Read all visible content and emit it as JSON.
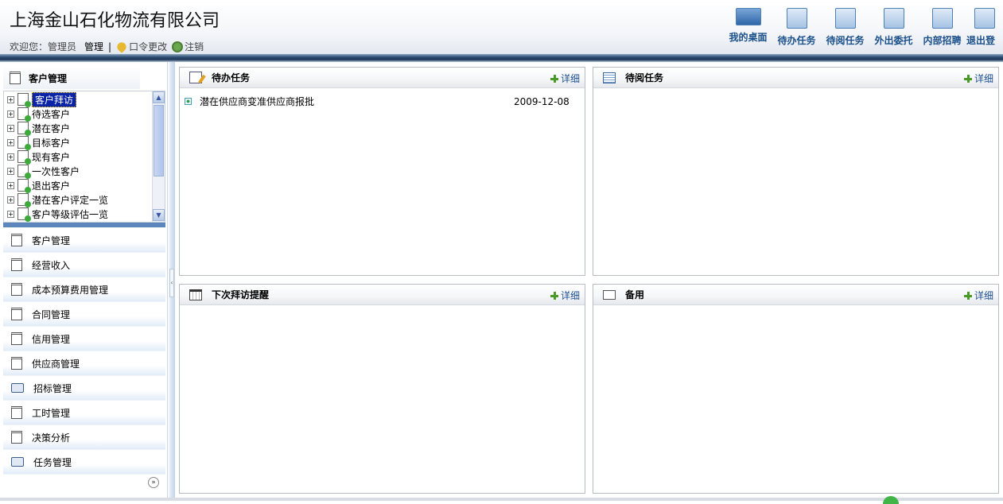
{
  "header": {
    "company": "上海金山石化物流有限公司",
    "welcome": "欢迎您：管理员",
    "manage": "管理",
    "separator": "|",
    "password_change": "口令更改",
    "logout": "注销"
  },
  "topnav": [
    {
      "label": "我的桌面",
      "icon": "desktop-icon"
    },
    {
      "label": "待办任务",
      "icon": "task-list-icon"
    },
    {
      "label": "待阅任务",
      "icon": "table-icon"
    },
    {
      "label": "外出委托",
      "icon": "delegate-icon"
    },
    {
      "label": "内部招聘",
      "icon": "recruit-icon"
    },
    {
      "label": "退出登",
      "icon": "exit-icon"
    }
  ],
  "sidebar": {
    "header": "客户管理",
    "tree": [
      {
        "label": "客户拜访",
        "selected": true
      },
      {
        "label": "待选客户"
      },
      {
        "label": "潜在客户"
      },
      {
        "label": "目标客户"
      },
      {
        "label": "现有客户"
      },
      {
        "label": "一次性客户"
      },
      {
        "label": "退出客户"
      },
      {
        "label": "潜在客户评定一览"
      },
      {
        "label": "客户等级评估一览"
      }
    ],
    "menu": [
      {
        "label": "客户管理",
        "icon": "notebook-icon"
      },
      {
        "label": "经营收入",
        "icon": "notebook-icon"
      },
      {
        "label": "成本预算费用管理",
        "icon": "notebook-icon"
      },
      {
        "label": "合同管理",
        "icon": "notebook-icon"
      },
      {
        "label": "信用管理",
        "icon": "notebook-icon"
      },
      {
        "label": "供应商管理",
        "icon": "notebook-icon"
      },
      {
        "label": "招标管理",
        "icon": "book-icon"
      },
      {
        "label": "工时管理",
        "icon": "notebook-icon"
      },
      {
        "label": "决策分析",
        "icon": "notebook-icon"
      },
      {
        "label": "任务管理",
        "icon": "book-icon"
      }
    ]
  },
  "panels": {
    "todo": {
      "title": "待办任务",
      "more": "详细",
      "items": [
        {
          "text": "潜在供应商变准供应商报批",
          "date": "2009-12-08"
        }
      ]
    },
    "toread": {
      "title": "待阅任务",
      "more": "详细"
    },
    "nextvisit": {
      "title": "下次拜访提醒",
      "more": "详细"
    },
    "spare": {
      "title": "备用",
      "more": "详细"
    }
  }
}
